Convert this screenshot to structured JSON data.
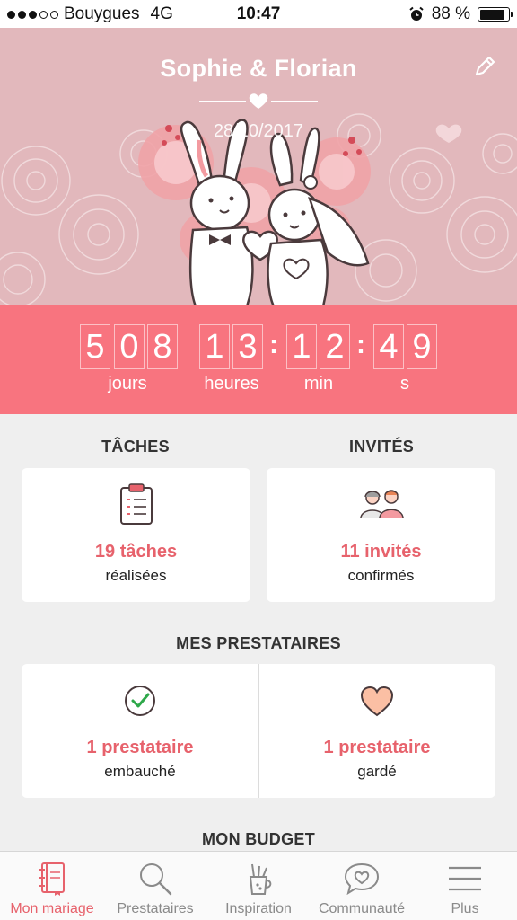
{
  "status_bar": {
    "carrier": "Bouygues",
    "network": "4G",
    "time": "10:47",
    "battery": "88 %",
    "battery_level": 0.88
  },
  "hero": {
    "couple": "Sophie & Florian",
    "date": "28/10/2017"
  },
  "countdown": {
    "days": [
      "5",
      "0",
      "8"
    ],
    "hours": [
      "1",
      "3"
    ],
    "minutes": [
      "1",
      "2"
    ],
    "seconds": [
      "4",
      "9"
    ],
    "labels": {
      "days": "jours",
      "hours": "heures",
      "minutes": "min",
      "seconds": "s"
    }
  },
  "tasks": {
    "title": "TÂCHES",
    "value": "19 tâches",
    "sub": "réalisées"
  },
  "guests": {
    "title": "INVITÉS",
    "value": "11 invités",
    "sub": "confirmés"
  },
  "vendors": {
    "title": "MES PRESTATAIRES",
    "hired_value": "1 prestataire",
    "hired_sub": "embauché",
    "saved_value": "1 prestataire",
    "saved_sub": "gardé"
  },
  "budget": {
    "title": "MON BUDGET"
  },
  "tabs": [
    {
      "label": "Mon mariage",
      "icon": "notebook-icon",
      "active": true
    },
    {
      "label": "Prestataires",
      "icon": "search-icon",
      "active": false
    },
    {
      "label": "Inspiration",
      "icon": "pencil-cup-icon",
      "active": false
    },
    {
      "label": "Communauté",
      "icon": "chat-heart-icon",
      "active": false
    },
    {
      "label": "Plus",
      "icon": "menu-icon",
      "active": false
    }
  ],
  "colors": {
    "accent": "#f8747f",
    "accent_text": "#e7626c",
    "hero_bg": "#e2b8bc"
  }
}
